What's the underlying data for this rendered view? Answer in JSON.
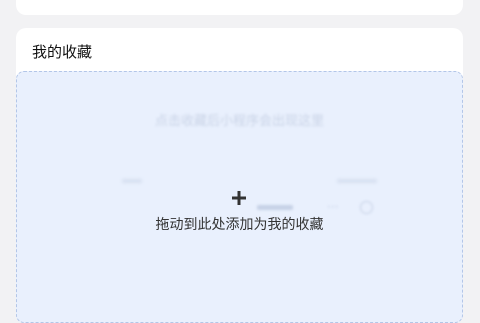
{
  "favorites": {
    "title": "我的收藏",
    "drop_zone": {
      "hint": "点击收藏后小程序会出现这里",
      "label": "拖动到此处添加为我的收藏",
      "icon": "plus-icon"
    }
  },
  "colors": {
    "background": "#f2f2f4",
    "card": "#ffffff",
    "drop_zone_fill": "#e9f0fd",
    "drop_zone_border": "#b3c6e8"
  }
}
